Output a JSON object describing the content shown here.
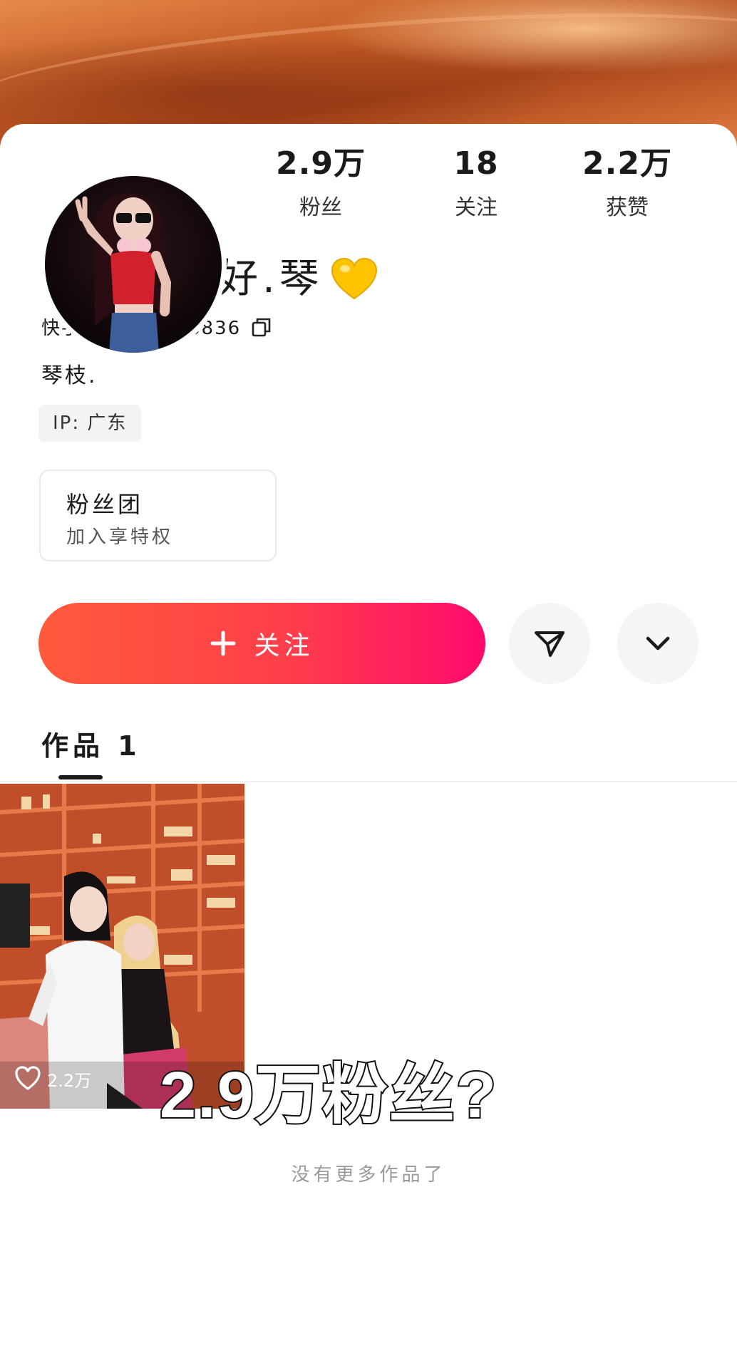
{
  "profile": {
    "name": "张艾嘉很好.琴",
    "kuaishou_id": "快手号:4652428836",
    "bio": "琴枝.",
    "ip": "IP: 广东"
  },
  "stats": [
    {
      "value": "2.9万",
      "label": "粉丝"
    },
    {
      "value": "18",
      "label": "关注"
    },
    {
      "value": "2.2万",
      "label": "获赞"
    }
  ],
  "fan_club": {
    "title": "粉丝团",
    "subtitle": "加入享特权"
  },
  "actions": {
    "follow_label": "关注"
  },
  "tabs": [
    {
      "label": "作品 1"
    }
  ],
  "works": [
    {
      "likes": "2.2万"
    }
  ],
  "overlay_caption": "2.9万粉丝?",
  "footer": {
    "end_text": "没有更多作品了"
  },
  "colors": {
    "follow_start": "#ff5a3c",
    "follow_end": "#ff0a6c",
    "banner": "#c25a25"
  }
}
